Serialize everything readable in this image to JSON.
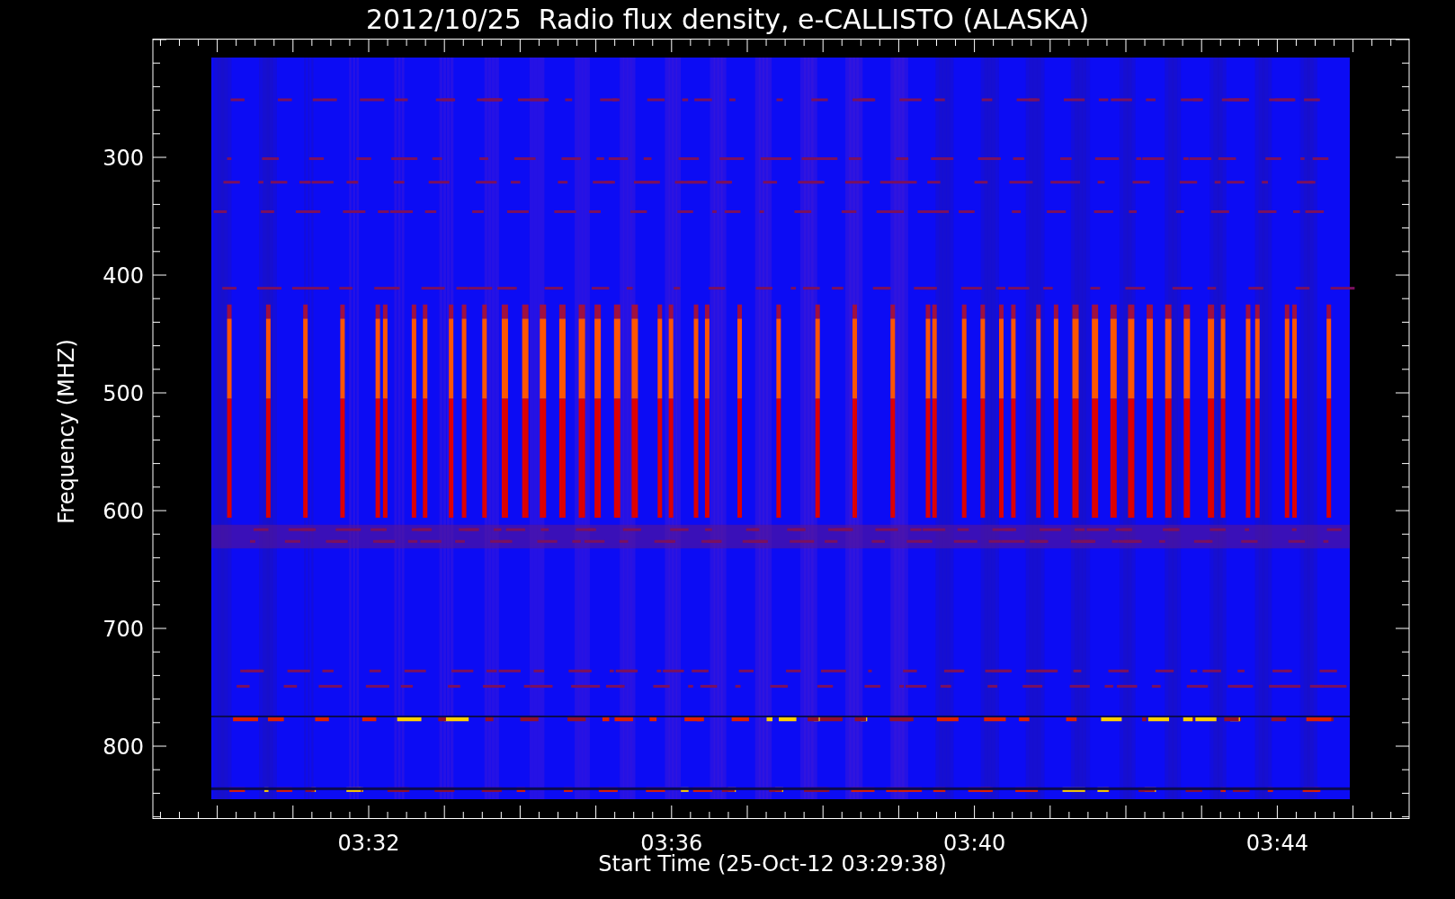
{
  "title": "2012/10/25  Radio flux density, e-CALLISTO (ALASKA)",
  "y_axis": {
    "label": "Frequency (MHZ)",
    "ticks": [
      "300",
      "400",
      "500",
      "600",
      "700",
      "800"
    ]
  },
  "x_axis": {
    "label": "Start Time (25-Oct-12 03:29:38)",
    "ticks": [
      "03:32",
      "03:36",
      "03:40",
      "03:44"
    ]
  }
}
